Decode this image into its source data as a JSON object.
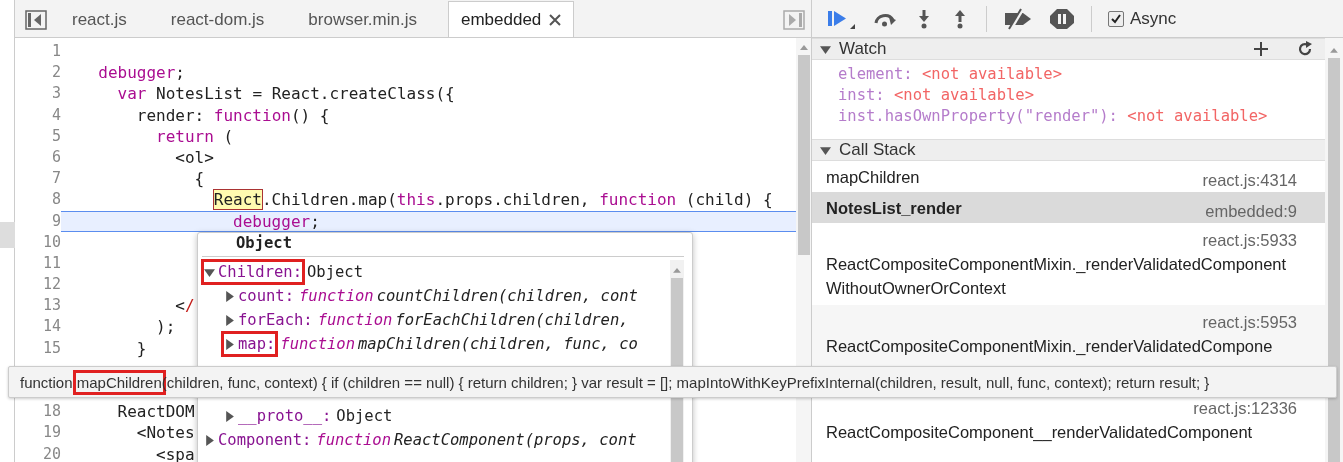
{
  "editor": {
    "tabs": [
      {
        "label": "react.js",
        "selected": false
      },
      {
        "label": "react-dom.js",
        "selected": false
      },
      {
        "label": "browser.min.js",
        "selected": false
      },
      {
        "label": "embedded",
        "selected": true,
        "closable": true
      }
    ],
    "lines": [
      {
        "number": "1",
        "current": false
      },
      {
        "number": "2",
        "current": false,
        "tokens": [
          {
            "kind": "keyword",
            "text": "debugger"
          },
          {
            "kind": "plain",
            "text": ";"
          }
        ]
      },
      {
        "number": "3",
        "current": false,
        "tokens": [
          {
            "kind": "keyword",
            "text": "var"
          },
          {
            "kind": "plain",
            "text": " NotesList = React.createClass({"
          }
        ]
      },
      {
        "number": "4",
        "current": false,
        "tokens": [
          {
            "kind": "plain",
            "text": "render: "
          },
          {
            "kind": "keyword",
            "text": "function"
          },
          {
            "kind": "plain",
            "text": "() {"
          }
        ]
      },
      {
        "number": "5",
        "current": false,
        "tokens": [
          {
            "kind": "keyword",
            "text": "return"
          },
          {
            "kind": "plain",
            "text": " ("
          }
        ]
      },
      {
        "number": "6",
        "current": false,
        "tokens": [
          {
            "kind": "plain",
            "text": "<ol>"
          }
        ]
      },
      {
        "number": "7",
        "current": false,
        "tokens": [
          {
            "kind": "plain",
            "text": "{"
          }
        ]
      },
      {
        "number": "8",
        "current": false,
        "tokens": [
          {
            "kind": "highlight",
            "text": "React"
          },
          {
            "kind": "plain",
            "text": ".Children.map("
          },
          {
            "kind": "keyword",
            "text": "this"
          },
          {
            "kind": "plain",
            "text": ".props.children, "
          },
          {
            "kind": "keyword",
            "text": "function"
          },
          {
            "kind": "plain",
            "text": " (child) {"
          }
        ]
      },
      {
        "number": "9",
        "current": true,
        "tokens": [
          {
            "kind": "keyword",
            "text": "debugger"
          },
          {
            "kind": "plain",
            "text": ";"
          }
        ]
      },
      {
        "number": "10",
        "current": false
      },
      {
        "number": "11",
        "current": false
      },
      {
        "number": "12",
        "current": false
      },
      {
        "number": "13",
        "current": false,
        "tokens": [
          {
            "kind": "plain",
            "text": "<"
          },
          {
            "kind": "tag",
            "text": "/"
          }
        ]
      },
      {
        "number": "14",
        "current": false,
        "tokens": [
          {
            "kind": "plain",
            "text": ");"
          }
        ]
      },
      {
        "number": "15",
        "current": false,
        "tokens": [
          {
            "kind": "plain",
            "text": "}"
          }
        ]
      },
      {
        "number": "18",
        "current": false,
        "tokens": [
          {
            "kind": "plain",
            "text": "ReactDOM"
          }
        ]
      },
      {
        "number": "19",
        "current": false,
        "tokens": [
          {
            "kind": "plain",
            "text": "<Notes"
          }
        ]
      },
      {
        "number": "20",
        "current": false,
        "tokens": [
          {
            "kind": "plain",
            "text": "<spa"
          }
        ]
      }
    ]
  },
  "popover": {
    "title": "Object",
    "rows": [
      {
        "key": "Children:",
        "value": "Object",
        "expanded": true,
        "marked": true,
        "children": [
          {
            "key": "count:",
            "keyword": "function",
            "value": "countChildren(children, cont",
            "expanded": false,
            "marked": false
          },
          {
            "key": "forEach:",
            "keyword": "function",
            "value": "forEachChildren(children,",
            "expanded": false,
            "marked": false
          },
          {
            "key": "map:",
            "keyword": "function",
            "value": "mapChildren(children, func, co",
            "expanded": false,
            "marked": true
          },
          {
            "key": "__proto__:",
            "value": "Object",
            "expanded": false,
            "marked": false
          }
        ]
      },
      {
        "key": "Component:",
        "keyword": "function",
        "value": "ReactComponent(props, cont",
        "expanded": false,
        "marked": false
      }
    ]
  },
  "tooltip": {
    "before": "function ",
    "marked": "mapChildren",
    "after": "(children, func, context) { if (children == null) { return children; } var result = []; mapIntoWithKeyPrefixInternal(children, result, null, func, context); return result; }"
  },
  "debugger": {
    "async": {
      "label": "Async",
      "checked": true
    },
    "watch": {
      "title": "Watch",
      "expanded": true,
      "items": [
        {
          "name": "element:",
          "value": "<not available>"
        },
        {
          "name": "inst:",
          "value": "<not available>"
        },
        {
          "name": "inst.hasOwnProperty(\"render\"):",
          "value": "<not available>"
        }
      ]
    },
    "call_stack": {
      "title": "Call Stack",
      "expanded": true,
      "frames": [
        {
          "kind": "inline",
          "name": "mapChildren",
          "location": "react.js:4314",
          "selected": false
        },
        {
          "kind": "inline",
          "name": "NotesList_render",
          "location": "embedded:9",
          "selected": true
        },
        {
          "kind": "wrapped",
          "name": "ReactCompositeComponentMixin._renderValidatedComponentWithoutOwnerOrContext",
          "location": "react.js:5933",
          "selected": false
        },
        {
          "kind": "wrapped",
          "name": "ReactCompositeComponentMixin._renderValidatedCompone",
          "location": "react.js:5953",
          "selected": false
        },
        {
          "kind": "wrapped",
          "name": "ReactCompositeComponent__renderValidatedComponent",
          "location": "react.js:12336",
          "selected": false
        }
      ]
    }
  }
}
